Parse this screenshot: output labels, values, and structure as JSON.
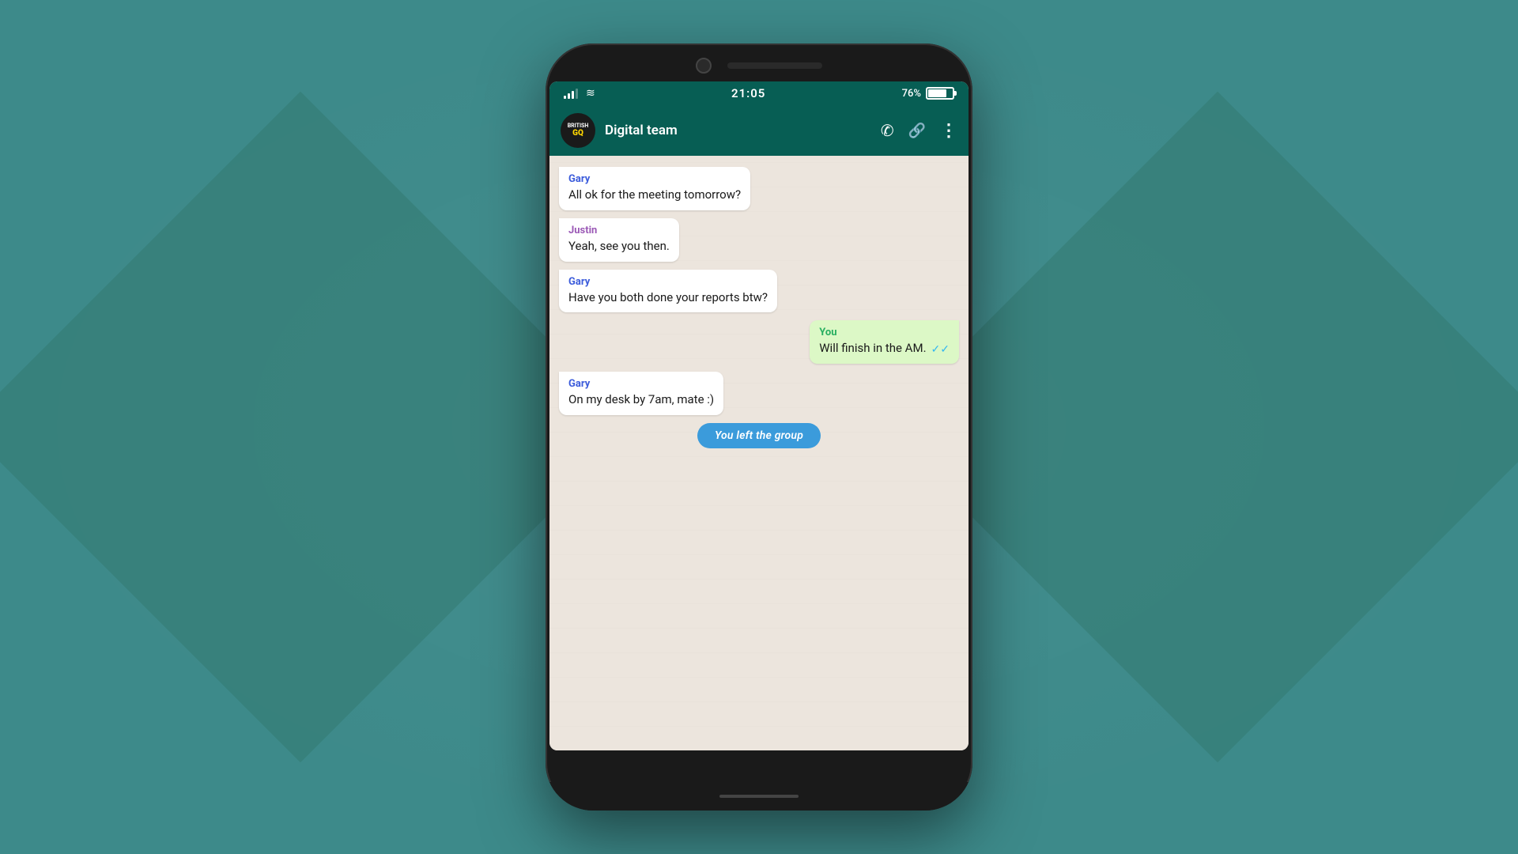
{
  "background": {
    "color": "#3d8a8a"
  },
  "phone": {
    "status_bar": {
      "time": "21:05",
      "battery_percent": "76%",
      "signal_bars": 3
    },
    "header": {
      "group_name": "Digital team",
      "logo_brand": "BRITISH",
      "logo_letters": "GQ"
    },
    "messages": [
      {
        "id": "msg1",
        "sender": "Gary",
        "sender_type": "gary",
        "text": "All ok for the meeting tomorrow?",
        "direction": "incoming"
      },
      {
        "id": "msg2",
        "sender": "Justin",
        "sender_type": "justin",
        "text": "Yeah, see you then.",
        "direction": "incoming"
      },
      {
        "id": "msg3",
        "sender": "Gary",
        "sender_type": "gary",
        "text": "Have you both done your reports btw?",
        "direction": "incoming"
      },
      {
        "id": "msg4",
        "sender": "You",
        "sender_type": "you",
        "text": "Will finish in the AM.",
        "direction": "outgoing",
        "read": true
      },
      {
        "id": "msg5",
        "sender": "Gary",
        "sender_type": "gary",
        "text": "On my desk by 7am, mate :)",
        "direction": "incoming"
      }
    ],
    "system_message": "You left the group",
    "icons": {
      "phone": "📞",
      "link": "🔗",
      "menu": "⋮"
    }
  }
}
